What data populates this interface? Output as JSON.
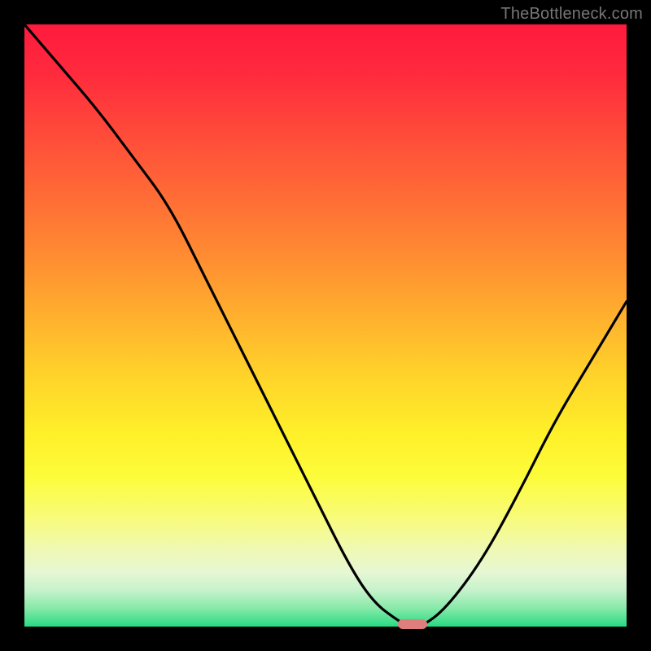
{
  "watermark": "TheBottleneck.com",
  "chart_data": {
    "type": "line",
    "title": "",
    "xlabel": "",
    "ylabel": "",
    "xlim": [
      0,
      100
    ],
    "ylim": [
      0,
      100
    ],
    "grid": false,
    "series": [
      {
        "name": "bottleneck-curve",
        "x": [
          0,
          6,
          12,
          18,
          24,
          30,
          36,
          42,
          48,
          54,
          58,
          62,
          64,
          66,
          70,
          76,
          82,
          88,
          94,
          100
        ],
        "values": [
          100,
          93,
          86,
          78,
          70,
          58,
          46,
          34,
          22,
          10,
          4,
          1,
          0,
          0,
          3,
          11,
          22,
          34,
          44,
          54
        ]
      }
    ],
    "minimum_marker": {
      "x": 64.5,
      "y": 0
    },
    "gradient_stops": [
      {
        "pos": 0,
        "color": "#ff1a3d"
      },
      {
        "pos": 50,
        "color": "#ffd22a"
      },
      {
        "pos": 80,
        "color": "#fdfc3a"
      },
      {
        "pos": 100,
        "color": "#28da83"
      }
    ]
  }
}
